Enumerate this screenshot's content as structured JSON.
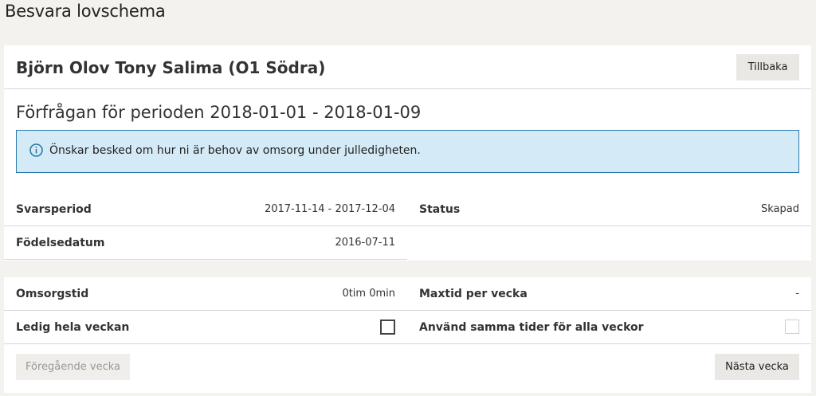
{
  "page": {
    "title": "Besvara lovschema"
  },
  "header": {
    "name": "Björn Olov Tony Salima (O1 Södra)",
    "back_label": "Tillbaka"
  },
  "request": {
    "period_title": "Förfrågan för perioden 2018-01-01 - 2018-01-09",
    "info_icon": "info-icon",
    "info_text": "Önskar besked om hur ni är behov av omsorg under julledigheten."
  },
  "details": {
    "svarsperiod_label": "Svarsperiod",
    "svarsperiod_value": "2017-11-14 - 2017-12-04",
    "status_label": "Status",
    "status_value": "Skapad",
    "fodelsedatum_label": "Födelsedatum",
    "fodelsedatum_value": "2016-07-11"
  },
  "week": {
    "omsorgstid_label": "Omsorgstid",
    "omsorgstid_value": "0tim 0min",
    "maxtid_label": "Maxtid per vecka",
    "maxtid_value": "-",
    "ledig_label": "Ledig hela veckan",
    "ledig_checked": false,
    "samma_tider_label": "Använd samma tider för alla veckor",
    "samma_tider_checked": false,
    "samma_tider_disabled": true,
    "prev_label": "Föregående vecka",
    "prev_disabled": true,
    "next_label": "Nästa vecka"
  },
  "colors": {
    "background": "#f3f2ee",
    "info_bg": "#d4ebf7",
    "info_border": "#2a78a8",
    "button_bg": "#e9e8e4"
  }
}
